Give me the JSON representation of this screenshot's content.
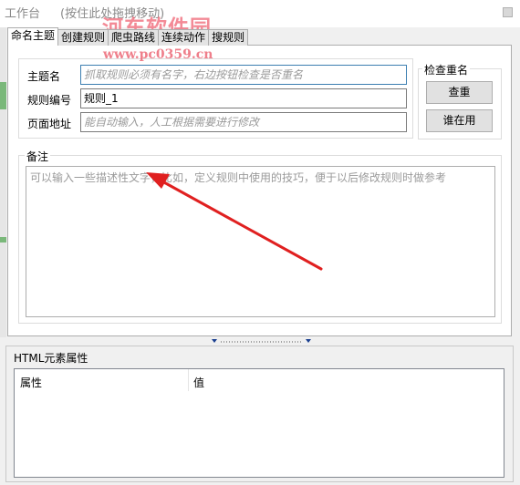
{
  "window": {
    "title": "工作台",
    "drag_hint": "(按住此处拖拽移动)",
    "watermark": "河东软件园",
    "watermark_url": "www.pc0359.cn"
  },
  "tabs": [
    {
      "label": "命名主题",
      "active": true
    },
    {
      "label": "创建规则",
      "active": false
    },
    {
      "label": "爬虫路线",
      "active": false
    },
    {
      "label": "连续动作",
      "active": false
    },
    {
      "label": "搜规则",
      "active": false
    }
  ],
  "form": {
    "topic_label": "主题名",
    "topic_placeholder": "抓取规则必须有名字，右边按钮检查是否重名",
    "rule_no_label": "规则编号",
    "rule_no_value": "规则_1",
    "page_url_label": "页面地址",
    "page_url_placeholder": "能自动输入，人工根据需要进行修改"
  },
  "check_group": {
    "legend": "检查重名",
    "check_button": "查重",
    "who_uses_button": "谁在用"
  },
  "notes": {
    "legend": "备注",
    "placeholder": "可以输入一些描述性文字，比如，定义规则中使用的技巧，便于以后修改规则时做参考"
  },
  "html_props": {
    "title": "HTML元素属性",
    "columns": [
      "属性",
      "值"
    ]
  },
  "colors": {
    "arrow": "#e02020",
    "focus_border": "#3c7fb1"
  }
}
